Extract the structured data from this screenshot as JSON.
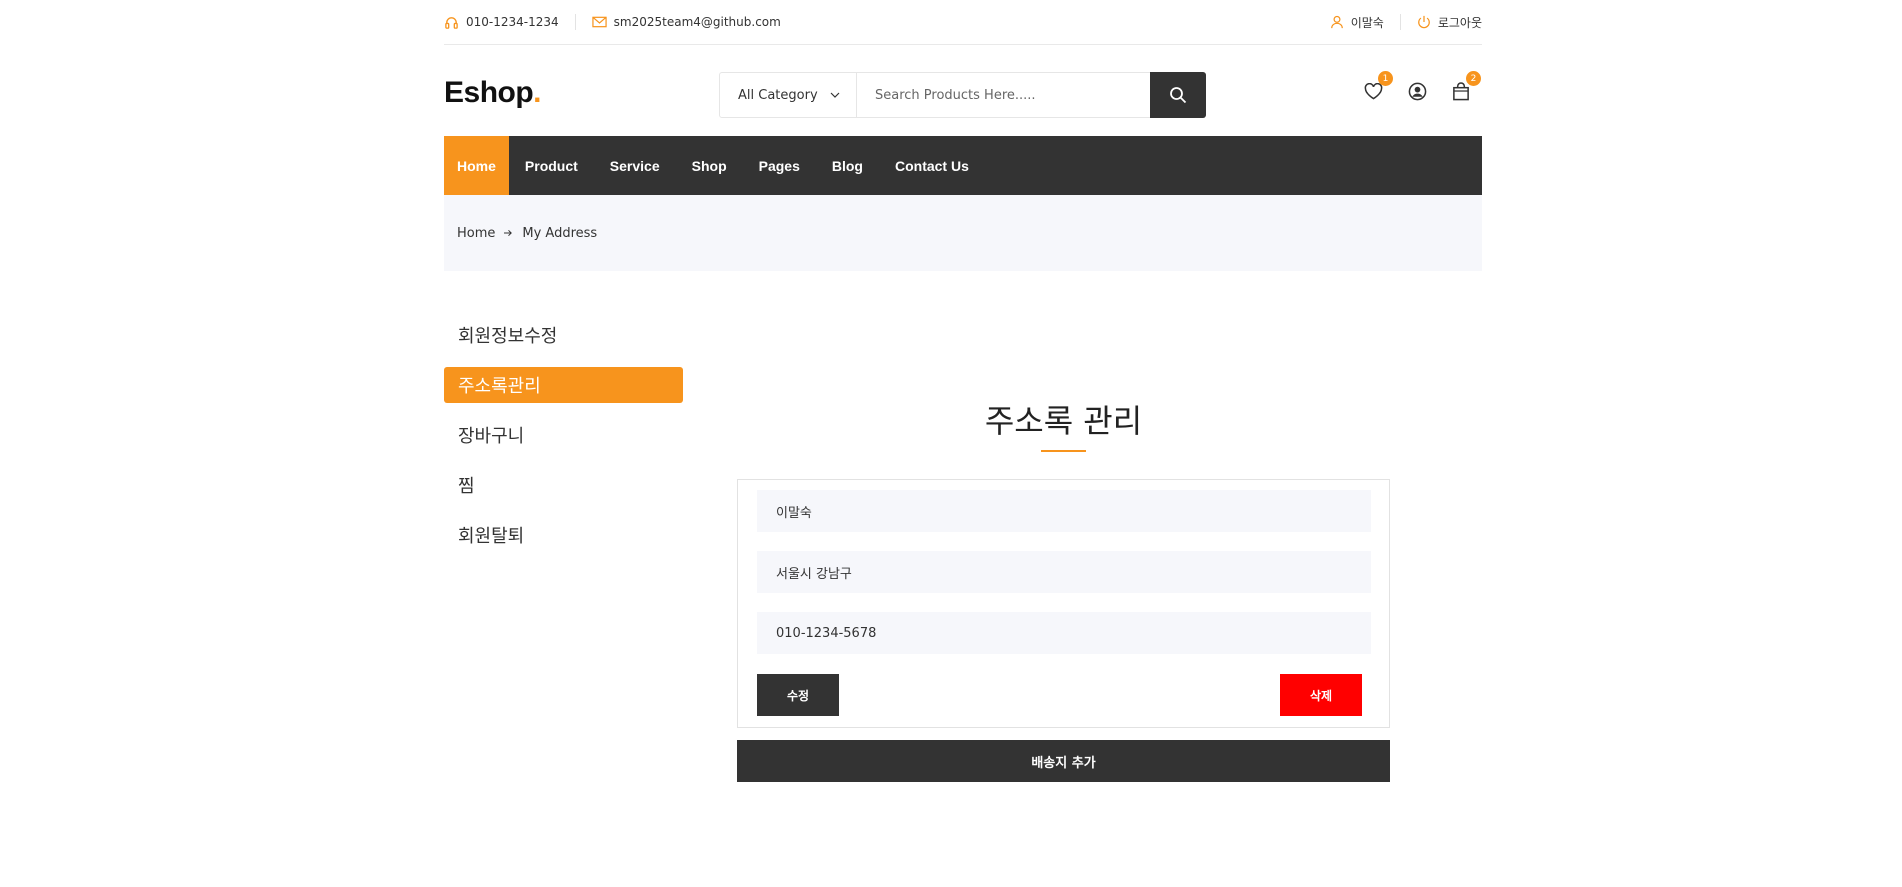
{
  "topbar": {
    "phone": "010-1234-1234",
    "email": "sm2025team4@github.com",
    "user_name": "이말숙",
    "logout": "로그아웃"
  },
  "header": {
    "logo_text": "Eshop",
    "logo_dot": ".",
    "category": "All Category",
    "search_placeholder": "Search Products Here.....",
    "wishlist_count": "1",
    "cart_count": "2"
  },
  "nav": {
    "items": [
      {
        "label": "Home",
        "active": true
      },
      {
        "label": "Product"
      },
      {
        "label": "Service"
      },
      {
        "label": "Shop"
      },
      {
        "label": "Pages"
      },
      {
        "label": "Blog"
      },
      {
        "label": "Contact Us"
      }
    ]
  },
  "breadcrumb": {
    "home": "Home",
    "current": "My Address"
  },
  "sidebar": {
    "items": [
      {
        "label": "회원정보수정"
      },
      {
        "label": "주소록관리",
        "active": true
      },
      {
        "label": "장바구니"
      },
      {
        "label": "찜"
      },
      {
        "label": "회원탈퇴"
      }
    ]
  },
  "main": {
    "title": "주소록 관리",
    "address": {
      "name": "이말숙",
      "address": "서울시 강남구",
      "phone": "010-1234-5678"
    },
    "edit_label": "수정",
    "delete_label": "삭제",
    "add_label": "배송지 추가"
  },
  "colors": {
    "accent": "#F7941D",
    "dark": "#333333",
    "danger": "#FF0000",
    "light_bg": "#F6F7FB"
  }
}
